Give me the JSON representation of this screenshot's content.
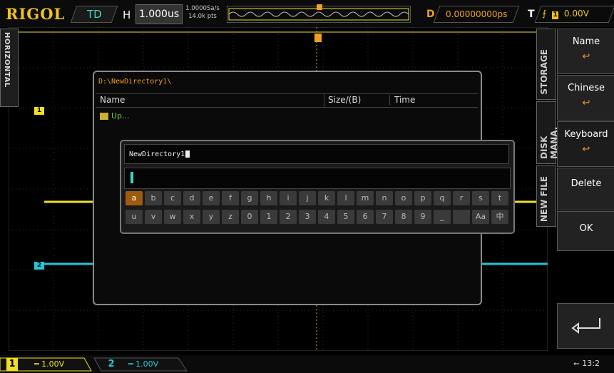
{
  "topbar": {
    "logo": "RIGOL",
    "mode": "TD",
    "h_label": "H",
    "h_value": "1.000us",
    "sample_rate": "1.0000Sa/s",
    "points": "14.0k pts",
    "d_label": "D",
    "d_value": "0.00000000ps",
    "t_label": "T",
    "t_value": "0.00V"
  },
  "left_tab": "HORIZONTAL",
  "right_tabs": [
    "STORAGE",
    "DISK MANA.",
    "NEW FILE"
  ],
  "menu": {
    "items": [
      {
        "label": "Name",
        "icon": "↩"
      },
      {
        "label": "Chinese",
        "icon": "↩"
      },
      {
        "label": "Keyboard",
        "icon": "↩"
      },
      {
        "label": "Delete",
        "icon": ""
      },
      {
        "label": "OK",
        "icon": ""
      }
    ]
  },
  "dialog": {
    "path": "D:\\NewDirectory1\\",
    "col_name": "Name",
    "col_size": "Size/(B)",
    "col_time": "Time",
    "up_label": "Up..."
  },
  "keyboard": {
    "filename": "NewDirectory1",
    "row1": [
      "a",
      "b",
      "c",
      "d",
      "e",
      "f",
      "g",
      "h",
      "i",
      "j",
      "k",
      "l",
      "m",
      "n",
      "o",
      "p",
      "q",
      "r",
      "s",
      "t"
    ],
    "row2": [
      "u",
      "v",
      "w",
      "x",
      "y",
      "z",
      "0",
      "1",
      "2",
      "3",
      "4",
      "5",
      "6",
      "7",
      "8",
      "9",
      "_",
      "",
      "Aa",
      "中"
    ],
    "selected": "a"
  },
  "bottombar": {
    "ch1_num": "1",
    "ch1_val": "1.00V",
    "ch2_num": "2",
    "ch2_val": "1.00V",
    "clock": "13:2"
  },
  "colors": {
    "ch1": "#f0e020",
    "ch2": "#20c8d8",
    "accent": "#f0a020"
  }
}
